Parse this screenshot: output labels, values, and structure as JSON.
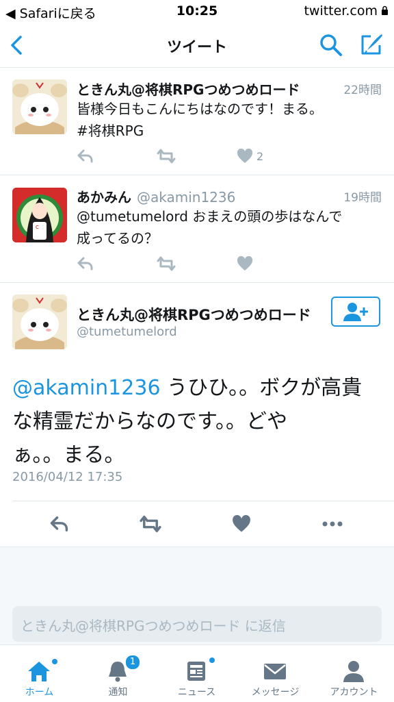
{
  "status_bar": {
    "back_label": "◀ Safariに戻る",
    "time": "10:25",
    "host": "twitter.com"
  },
  "nav": {
    "title": "ツイート"
  },
  "tweets": [
    {
      "name": "ときん丸@将棋RPGつめつめロード",
      "handle": "",
      "time": "22時間",
      "text_lines": [
        "皆様今日もこんにちはなのです！まる。",
        "#将棋RPG"
      ],
      "like_count": "2"
    },
    {
      "name": "あかみん",
      "handle": "@akamin1236",
      "time": "19時間",
      "text_lines": [
        "@tumetumelord おまえの頭の歩はなんで",
        "成ってるの？"
      ],
      "like_count": ""
    }
  ],
  "main_tweet": {
    "name": "ときん丸@将棋RPGつめつめロード",
    "handle": "@tumetumelord",
    "mention": "@akamin1236",
    "text_after_mention": " うひひ。。ボクが高貴",
    "text_line2": "な精霊だからなのです。。どや",
    "text_line3": "ぁ。。まる。",
    "date": "2016/04/12 17:35"
  },
  "reply": {
    "placeholder": "ときん丸@将棋RPGつめつめロード に返信"
  },
  "tabs": [
    {
      "label": "ホーム",
      "icon": "home-icon",
      "active": true,
      "dot": true
    },
    {
      "label": "通知",
      "icon": "bell-icon",
      "badge": "1"
    },
    {
      "label": "ニュース",
      "icon": "news-icon",
      "dot": true
    },
    {
      "label": "メッセージ",
      "icon": "envelope-icon"
    },
    {
      "label": "アカウント",
      "icon": "person-icon"
    }
  ],
  "colors": {
    "accent": "#1b95e0",
    "text": "#14171a",
    "muted": "#8899a6",
    "action": "#aab8c2"
  }
}
